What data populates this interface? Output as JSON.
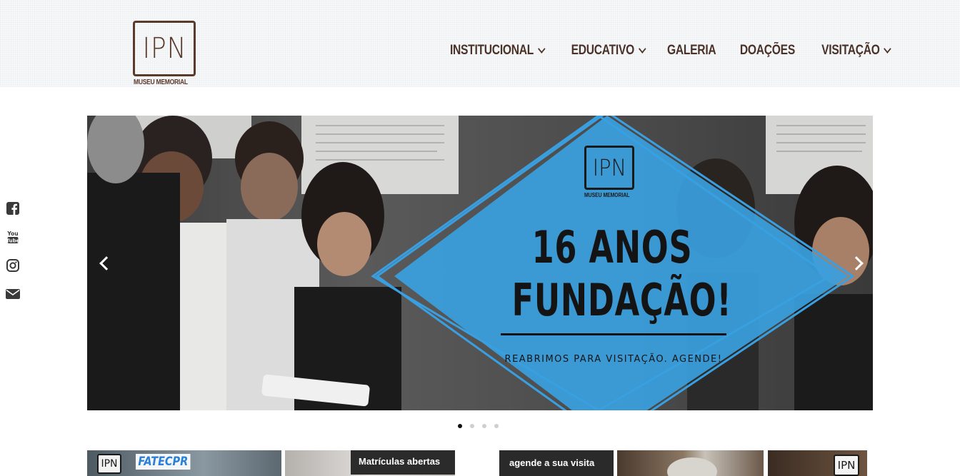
{
  "brand": {
    "logo_text": "IPN",
    "logo_subtitle": "MUSEU MEMORIAL"
  },
  "nav": {
    "items": [
      {
        "label": "INSTITUCIONAL",
        "has_dropdown": true
      },
      {
        "label": "EDUCATIVO",
        "has_dropdown": true
      },
      {
        "label": "GALERIA",
        "has_dropdown": false
      },
      {
        "label": "DOAÇÕES",
        "has_dropdown": false
      },
      {
        "label": "VISITAÇÃO",
        "has_dropdown": true
      }
    ]
  },
  "social": [
    "facebook-icon",
    "youtube-icon",
    "instagram-icon",
    "envelope-icon"
  ],
  "slider": {
    "logo_text": "IPN",
    "logo_subtitle": "MUSEU MEMORIAL",
    "headline_line1": "16 ANOS",
    "headline_line2": "FUNDAÇÃO!",
    "subline": "REABRIMOS PARA VISITAÇÃO. AGENDE!",
    "slide_count": 4,
    "active_slide": 1
  },
  "thumbnails": [
    {
      "logo_text": "IPN",
      "partner_text": "FATECPR"
    },
    {
      "label": "Matrículas abertas"
    },
    {
      "label": "agende a sua visita"
    },
    {
      "label": ""
    },
    {
      "logo_text": "IPN"
    }
  ],
  "colors": {
    "brand_brown": "#5a3a2a",
    "nav_text": "#4a3228",
    "slider_accent": "#3a9fe0"
  }
}
